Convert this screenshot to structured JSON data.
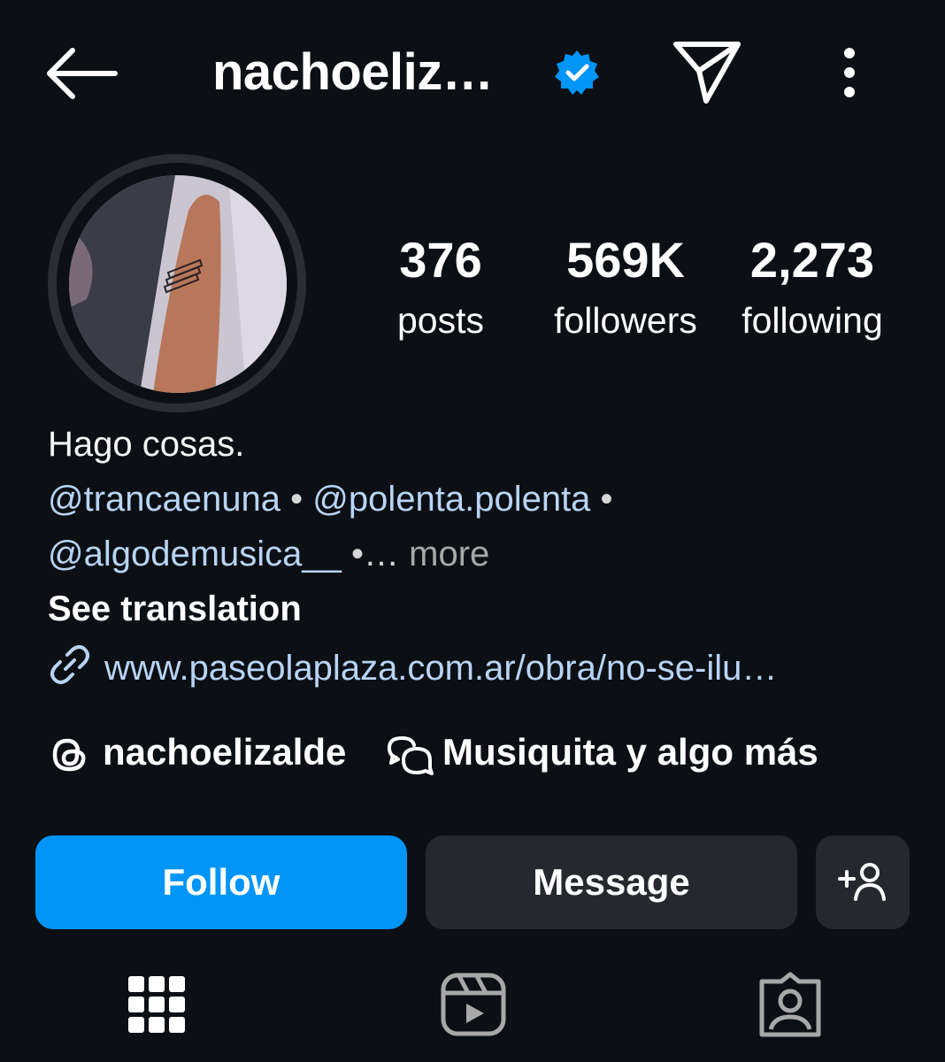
{
  "header": {
    "username": "nachoeliz…",
    "back_icon": "back-arrow-icon",
    "verified_icon": "verified-badge-icon",
    "send_icon": "send-icon",
    "more_icon": "more-vertical-icon"
  },
  "stats": {
    "posts": {
      "value": "376",
      "label": "posts"
    },
    "followers": {
      "value": "569K",
      "label": "followers"
    },
    "following": {
      "value": "2,273",
      "label": "following"
    }
  },
  "bio": {
    "text": "Hago cosas.",
    "mention_1": "@trancaenuna",
    "separator": " • ",
    "mention_2": "@polenta.polenta",
    "separator_end": " •",
    "mention_3": "@algodemusica__",
    "truncation": " •…",
    "more_label": " more",
    "see_translation": "See translation",
    "link": "www.paseolaplaza.com.ar/obra/no-se-ilu…"
  },
  "profile_links": {
    "threads_handle": "nachoelizalde",
    "channel_name": "Musiquita y algo más"
  },
  "actions": {
    "follow": "Follow",
    "message": "Message"
  },
  "tabs": {
    "grid_icon": "grid-icon",
    "reels_icon": "reels-icon",
    "tagged_icon": "tagged-icon"
  },
  "colors": {
    "background": "#0c1014",
    "accent": "#0095f6",
    "mention": "#b8d4f5",
    "secondary_button": "#25292e"
  }
}
